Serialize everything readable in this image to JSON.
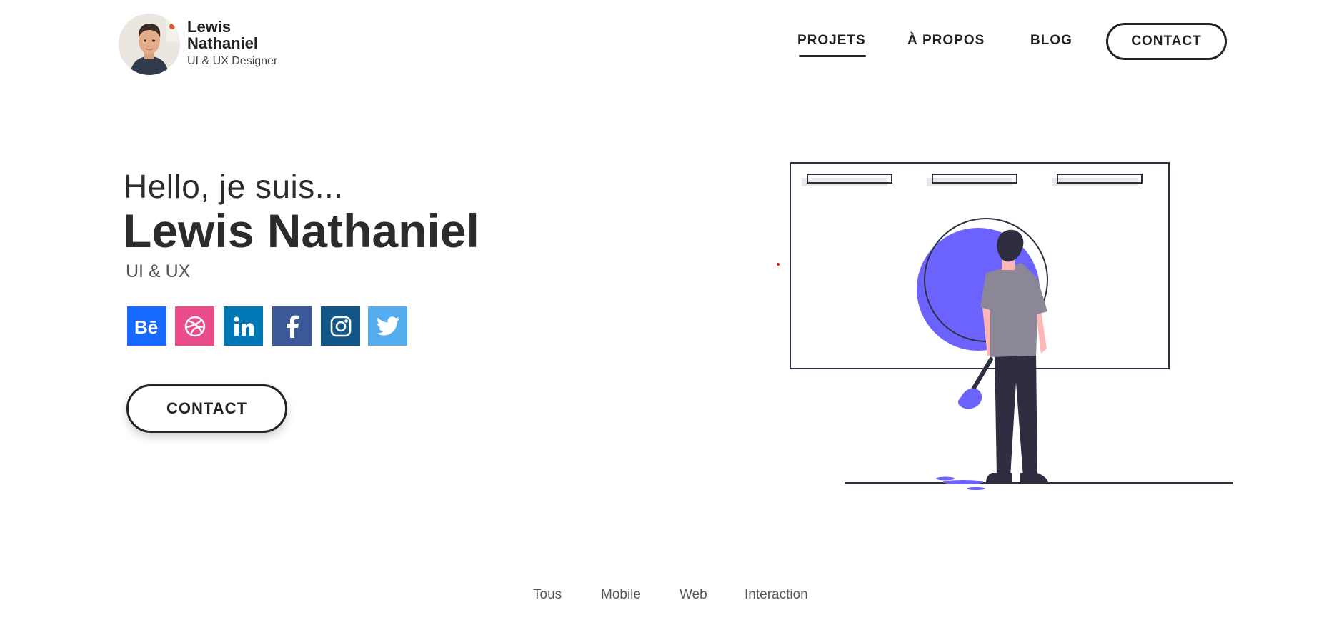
{
  "brand": {
    "name": "Lewis Nathaniel",
    "role": "UI & UX Designer"
  },
  "nav": {
    "items": [
      {
        "label": "PROJETS",
        "active": true
      },
      {
        "label": "À PROPOS",
        "active": false
      },
      {
        "label": "BLOG",
        "active": false
      }
    ],
    "contact_label": "CONTACT"
  },
  "hero": {
    "greeting": "Hello, je suis...",
    "name": "Lewis Nathaniel",
    "role": "UI & UX",
    "contact_label": "CONTACT"
  },
  "social": [
    {
      "icon": "behance-icon",
      "color": "#1769ff"
    },
    {
      "icon": "dribbble-icon",
      "color": "#ea4c89"
    },
    {
      "icon": "linkedin-icon",
      "color": "#0077b5"
    },
    {
      "icon": "facebook-icon",
      "color": "#3b5998"
    },
    {
      "icon": "instagram-icon",
      "color": "#125688"
    },
    {
      "icon": "twitter-icon",
      "color": "#55acee"
    }
  ],
  "filters": [
    "Tous",
    "Mobile",
    "Web",
    "Interaction"
  ],
  "colors": {
    "accent": "#6c63ff",
    "text": "#2b2b2b"
  }
}
